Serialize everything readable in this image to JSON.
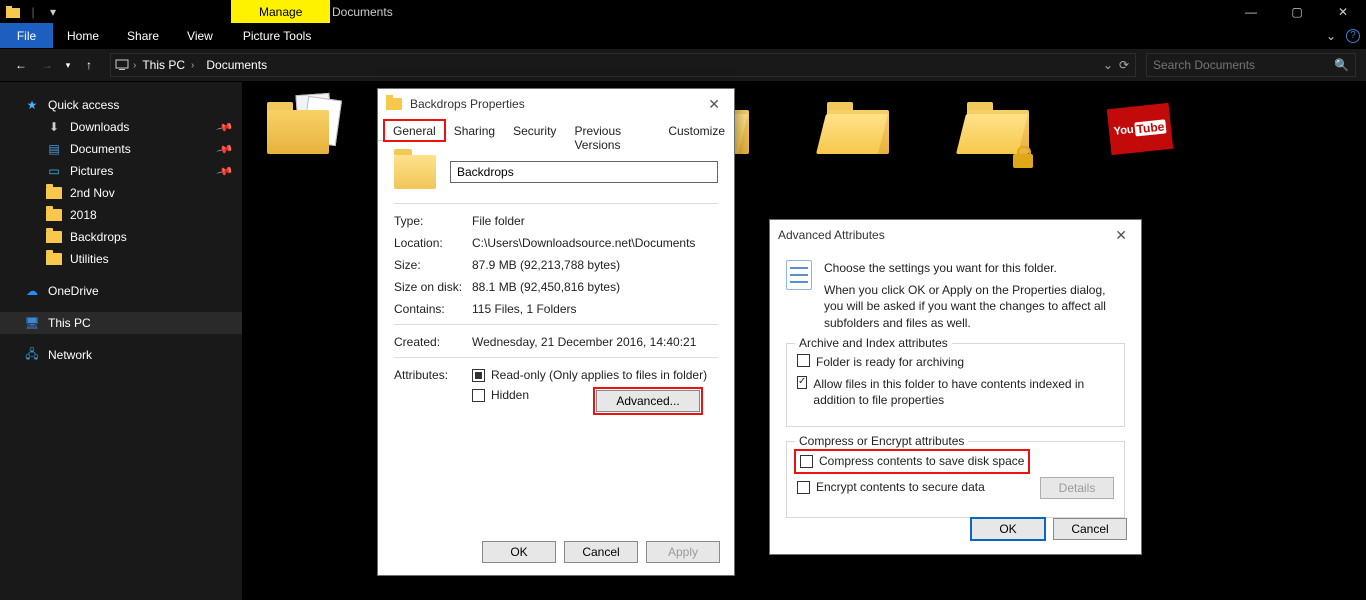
{
  "titlebar": {
    "manage": "Manage",
    "doc": "Documents"
  },
  "ribbon": {
    "file": "File",
    "home": "Home",
    "share": "Share",
    "view": "View",
    "picture_tools": "Picture Tools"
  },
  "crumb": {
    "this_pc": "This PC",
    "documents": "Documents"
  },
  "search": {
    "placeholder": "Search Documents"
  },
  "sidebar": {
    "quick": "Quick access",
    "downloads": "Downloads",
    "documents": "Documents",
    "pictures": "Pictures",
    "f1": "2nd Nov",
    "f2": "2018",
    "f3": "Backdrops",
    "f4": "Utilities",
    "onedrive": "OneDrive",
    "thispc": "This PC",
    "network": "Network"
  },
  "props": {
    "title": "Backdrops Properties",
    "tabs": {
      "general": "General",
      "sharing": "Sharing",
      "security": "Security",
      "prev": "Previous Versions",
      "customize": "Customize"
    },
    "name": "Backdrops",
    "type_k": "Type:",
    "type_v": "File folder",
    "loc_k": "Location:",
    "loc_v": "C:\\Users\\Downloadsource.net\\Documents",
    "size_k": "Size:",
    "size_v": "87.9 MB (92,213,788 bytes)",
    "disk_k": "Size on disk:",
    "disk_v": "88.1 MB (92,450,816 bytes)",
    "contains_k": "Contains:",
    "contains_v": "115 Files, 1 Folders",
    "created_k": "Created:",
    "created_v": "Wednesday, 21 December 2016, 14:40:21",
    "attr_k": "Attributes:",
    "readonly": "Read-only (Only applies to files in folder)",
    "hidden": "Hidden",
    "advanced": "Advanced...",
    "ok": "OK",
    "cancel": "Cancel",
    "apply": "Apply"
  },
  "adv": {
    "title": "Advanced Attributes",
    "desc1": "Choose the settings you want for this folder.",
    "desc2": "When you click OK or Apply on the Properties dialog, you will be asked if you want the changes to affect all subfolders and files as well.",
    "fs1": "Archive and Index attributes",
    "archive": "Folder is ready for archiving",
    "index": "Allow files in this folder to have contents indexed in addition to file properties",
    "fs2": "Compress or Encrypt attributes",
    "compress": "Compress contents to save disk space",
    "encrypt": "Encrypt contents to secure data",
    "details": "Details",
    "ok": "OK",
    "cancel": "Cancel"
  }
}
